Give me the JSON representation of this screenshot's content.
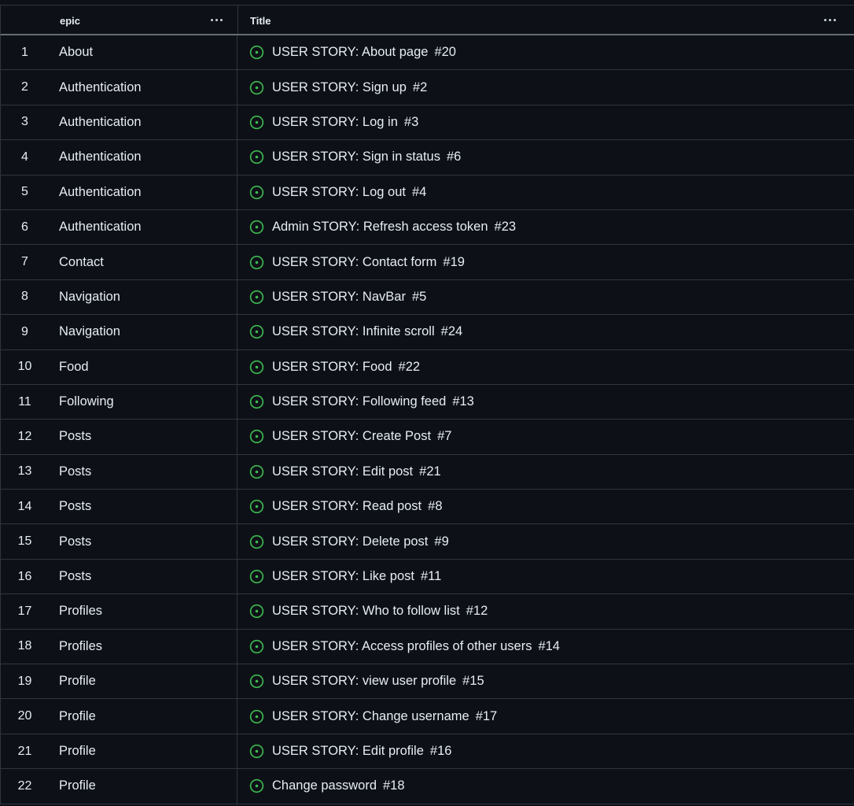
{
  "columns": {
    "epic": "epic",
    "title": "Title"
  },
  "colors": {
    "background": "#0d1117",
    "border": "#30363d",
    "text": "#e6edf3",
    "open_issue_icon": "#3fb950"
  },
  "icons": {
    "column_menu": "more-horizontal-icon",
    "issue_status": "issue-opened-icon"
  },
  "rows": [
    {
      "index": "1",
      "epic": "About",
      "title": "USER STORY: About page",
      "number": "#20"
    },
    {
      "index": "2",
      "epic": "Authentication",
      "title": "USER STORY: Sign up",
      "number": "#2"
    },
    {
      "index": "3",
      "epic": "Authentication",
      "title": "USER STORY: Log in",
      "number": "#3"
    },
    {
      "index": "4",
      "epic": "Authentication",
      "title": "USER STORY: Sign in status",
      "number": "#6"
    },
    {
      "index": "5",
      "epic": "Authentication",
      "title": "USER STORY: Log out",
      "number": "#4"
    },
    {
      "index": "6",
      "epic": "Authentication",
      "title": "Admin STORY: Refresh access token",
      "number": "#23"
    },
    {
      "index": "7",
      "epic": "Contact",
      "title": "USER STORY: Contact form",
      "number": "#19"
    },
    {
      "index": "8",
      "epic": "Navigation",
      "title": "USER STORY: NavBar",
      "number": "#5"
    },
    {
      "index": "9",
      "epic": "Navigation",
      "title": "USER STORY: Infinite scroll",
      "number": "#24"
    },
    {
      "index": "10",
      "epic": "Food",
      "title": "USER STORY: Food",
      "number": "#22"
    },
    {
      "index": "11",
      "epic": "Following",
      "title": "USER STORY: Following feed",
      "number": "#13"
    },
    {
      "index": "12",
      "epic": "Posts",
      "title": "USER STORY: Create Post",
      "number": "#7"
    },
    {
      "index": "13",
      "epic": "Posts",
      "title": "USER STORY: Edit post",
      "number": "#21"
    },
    {
      "index": "14",
      "epic": "Posts",
      "title": "USER STORY: Read post",
      "number": "#8"
    },
    {
      "index": "15",
      "epic": "Posts",
      "title": "USER STORY: Delete post",
      "number": "#9"
    },
    {
      "index": "16",
      "epic": "Posts",
      "title": "USER STORY: Like post",
      "number": "#11"
    },
    {
      "index": "17",
      "epic": "Profiles",
      "title": "USER STORY: Who to follow list",
      "number": "#12"
    },
    {
      "index": "18",
      "epic": "Profiles",
      "title": "USER STORY: Access profiles of other users",
      "number": "#14"
    },
    {
      "index": "19",
      "epic": "Profile",
      "title": "USER STORY: view user profile",
      "number": "#15"
    },
    {
      "index": "20",
      "epic": "Profile",
      "title": "USER STORY: Change username",
      "number": "#17"
    },
    {
      "index": "21",
      "epic": "Profile",
      "title": "USER STORY: Edit profile",
      "number": "#16"
    },
    {
      "index": "22",
      "epic": "Profile",
      "title": "Change password",
      "number": "#18"
    }
  ]
}
